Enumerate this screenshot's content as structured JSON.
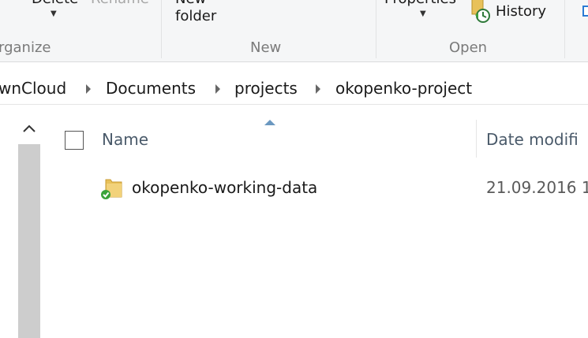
{
  "ribbon": {
    "organize": {
      "delete_label": "Delete",
      "rename_label": "Rename",
      "group_label": "rganize"
    },
    "new": {
      "new_folder_line1": "New",
      "new_folder_line2": "folder",
      "group_label": "New"
    },
    "open": {
      "properties_label": "Properties",
      "history_label": "History",
      "group_label": "Open"
    }
  },
  "breadcrumb": {
    "items": [
      "wnCloud",
      "Documents",
      "projects",
      "okopenko-project"
    ]
  },
  "columns": {
    "name": "Name",
    "date_modified": "Date modifi"
  },
  "files": [
    {
      "name": "okopenko-working-data",
      "date": "21.09.2016 1",
      "icon": "synced-folder-icon"
    }
  ],
  "colors": {
    "ribbon_bg": "#f5f6f7",
    "accent": "#6b98c0",
    "sync_green": "#3aa33a",
    "folder_yellow": "#e8c15a"
  }
}
